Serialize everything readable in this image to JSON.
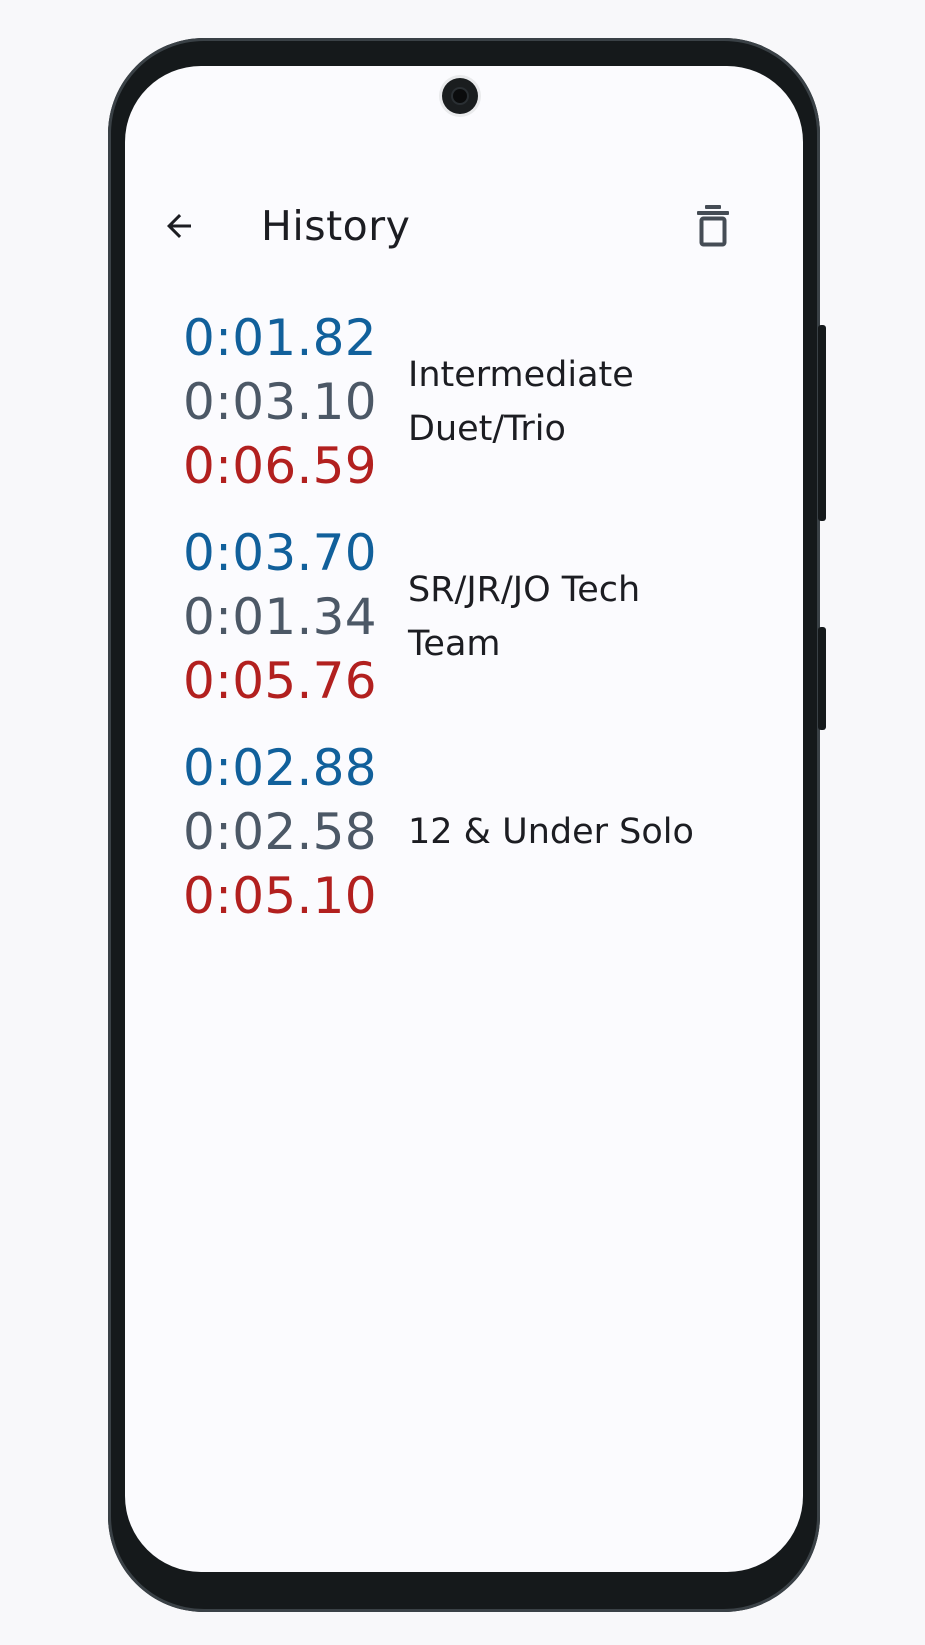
{
  "app_bar": {
    "title": "History",
    "back_icon": "arrow-back-icon",
    "delete_icon": "trash-icon"
  },
  "colors": {
    "time_1": "#11609b",
    "time_2": "#4c5866",
    "time_3": "#b2201f"
  },
  "history": [
    {
      "times": [
        "0:01.82",
        "0:03.10",
        "0:06.59"
      ],
      "event": "Intermediate Duet/Trio"
    },
    {
      "times": [
        "0:03.70",
        "0:01.34",
        "0:05.76"
      ],
      "event": "SR/JR/JO Tech Team"
    },
    {
      "times": [
        "0:02.88",
        "0:02.58",
        "0:05.10"
      ],
      "event": "12 & Under Solo"
    }
  ]
}
